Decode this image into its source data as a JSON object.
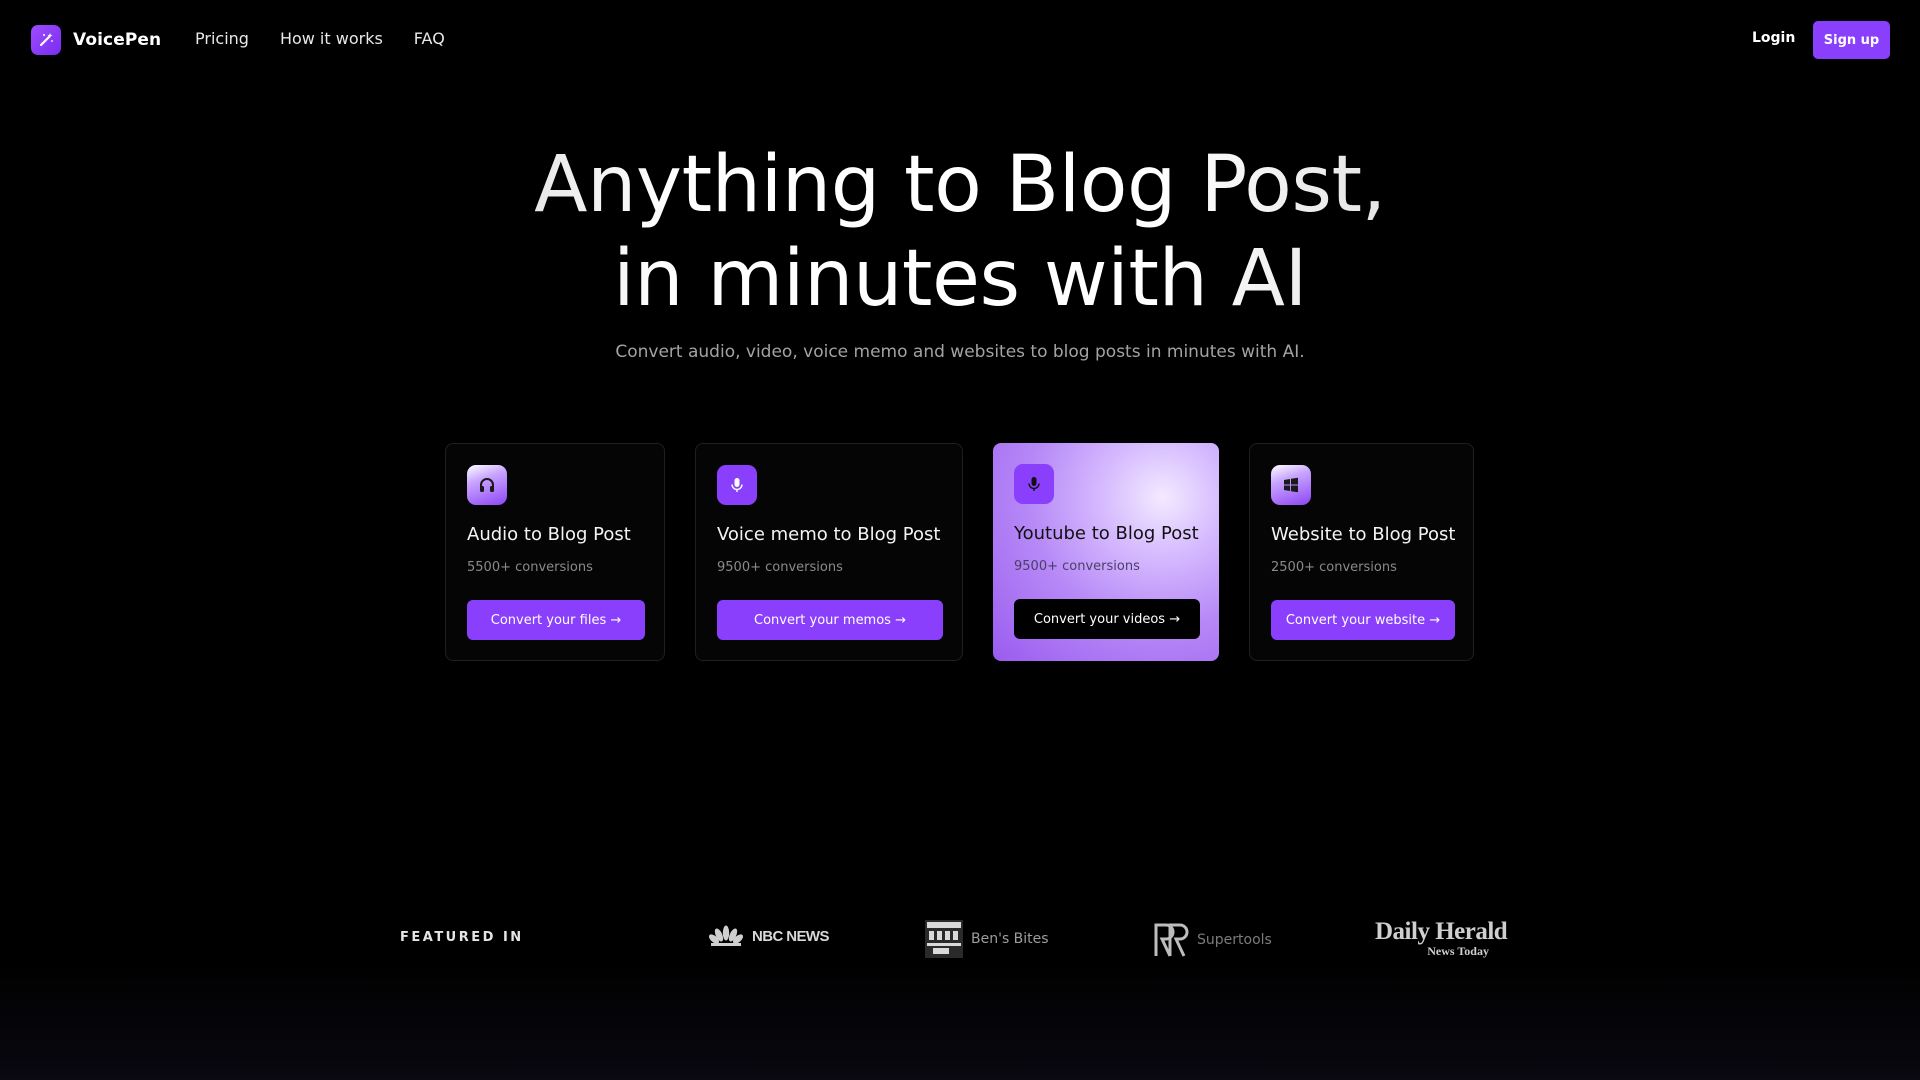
{
  "brand": {
    "name": "VoicePen"
  },
  "nav": {
    "links": [
      "Pricing",
      "How it works",
      "FAQ"
    ],
    "login": "Login",
    "signup": "Sign up"
  },
  "hero": {
    "title_line1_a": "Anything",
    "title_line1_b": "to Blog",
    "title_line1_c": "Post,",
    "title_line2_a": "in minutes",
    "title_line2_b": "with AI",
    "subtitle": "Convert audio, video, voice memo and websites to blog posts in minutes with AI."
  },
  "cards": [
    {
      "title": "Audio to Blog Post",
      "count": "5500+ conversions",
      "button": "Convert your files →",
      "icon": "headphones-icon"
    },
    {
      "title": "Voice memo to Blog Post",
      "count": "9500+ conversions",
      "button": "Convert your memos →",
      "icon": "microphone-icon"
    },
    {
      "title": "Youtube to Blog Post",
      "count": "9500+ conversions",
      "button": "Convert your videos →",
      "icon": "microphone-icon"
    },
    {
      "title": "Website to Blog Post",
      "count": "2500+ conversions",
      "button": "Convert your website →",
      "icon": "windows-icon"
    }
  ],
  "featured": {
    "label": "FEATURED IN",
    "logos": {
      "nbc": "NBC NEWS",
      "bens": "Ben's Bites",
      "supertools": "Supertools",
      "herald_top": "Daily Herald",
      "herald_bottom": "News Today"
    }
  },
  "colors": {
    "accent": "#8a3ffc",
    "background": "#000000"
  }
}
